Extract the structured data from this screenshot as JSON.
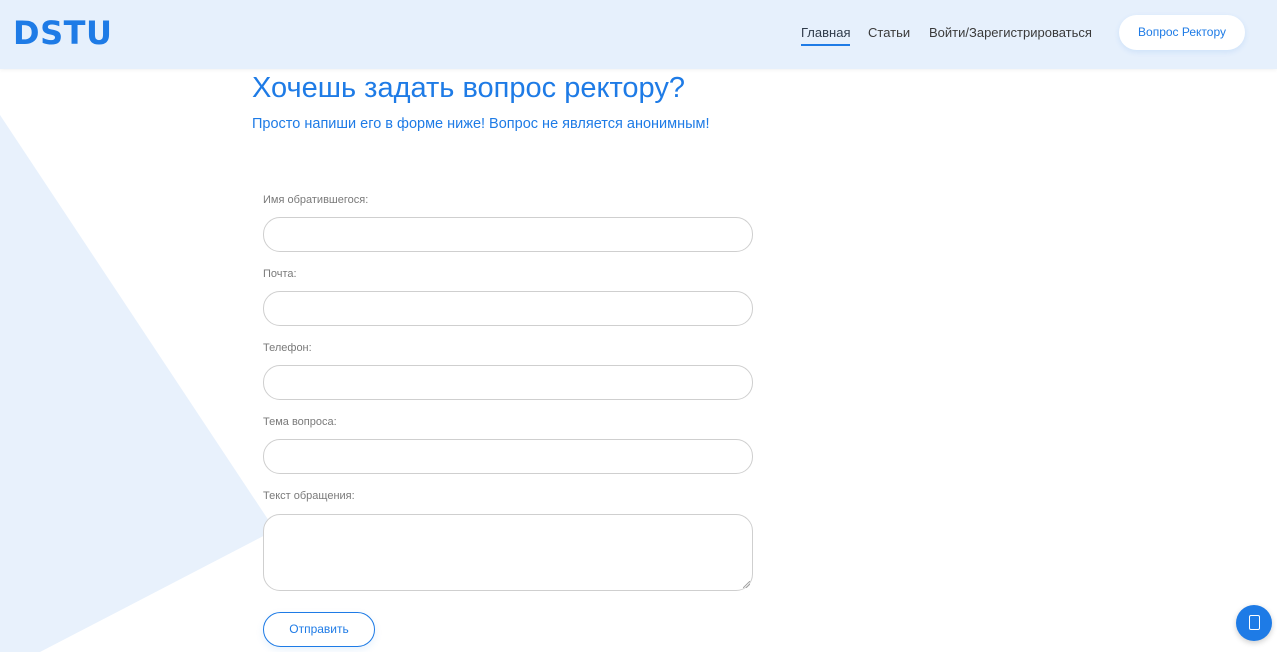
{
  "header": {
    "logo": "DSTU",
    "nav": [
      {
        "label": "Главная",
        "active": true
      },
      {
        "label": "Статьи",
        "active": false
      },
      {
        "label": "Войти/Зарегистрироваться",
        "active": false
      }
    ],
    "cta_label": "Вопрос Ректору"
  },
  "main": {
    "title": "Хочешь задать вопрос ректору?",
    "subtitle": "Просто напиши его в форме ниже! Вопрос не является анонимным!"
  },
  "form": {
    "fields": [
      {
        "label": "Имя обратившегося:",
        "value": ""
      },
      {
        "label": "Почта:",
        "value": ""
      },
      {
        "label": "Телефон:",
        "value": ""
      },
      {
        "label": "Тема вопроса:",
        "value": ""
      },
      {
        "label": "Текст обращения:",
        "value": ""
      }
    ],
    "submit_label": "Отправить"
  },
  "widgets": {
    "chat_icon": "chat-icon"
  },
  "colors": {
    "accent": "#1e7be6",
    "header_bg": "#e6f0fc",
    "bg_shape": "#e8f1fc"
  }
}
